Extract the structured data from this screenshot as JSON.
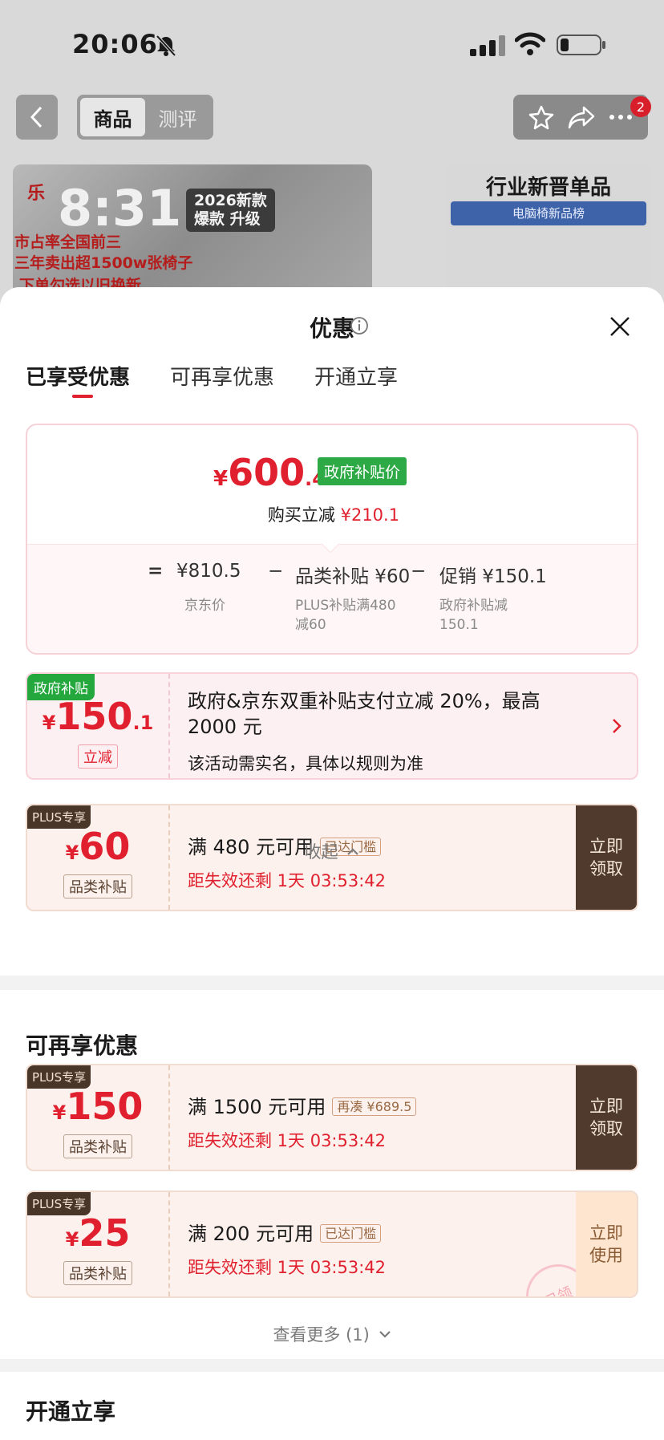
{
  "status_bar": {
    "time": "20:06"
  },
  "nav": {
    "tab_product": "商品",
    "tab_review": "测评",
    "badge_count": "2"
  },
  "banner": {
    "logo": "乐",
    "clock": "8:31",
    "tag_line1": "2026新款",
    "tag_line2": "爆款 升级",
    "line1": "市占率全国前三",
    "line2": "三年卖出超1500w张椅子",
    "line3": "下单勾选以旧换新",
    "side_title": "行业新晋单品",
    "side_strip": "电脑椅新品榜"
  },
  "sheet": {
    "title": "优惠",
    "tabs": [
      "已享受优惠",
      "可再享优惠",
      "开通立享"
    ]
  },
  "summary": {
    "currency": "¥",
    "price_int": "600",
    "price_dec": ".4",
    "gov_tag": "政府补贴价",
    "reduce_label": "购买立减",
    "reduce_amount": "¥210.1",
    "formula": {
      "eq": "=",
      "jd_price": "¥810.5",
      "minus1": "−",
      "category": "品类补贴 ¥60",
      "minus2": "−",
      "promo": "促销 ¥150.1",
      "jd_label": "京东价",
      "category_sub1": "PLUS补贴满480",
      "category_sub2": "减60",
      "promo_sub1": "政府补贴减",
      "promo_sub2": "150.1"
    }
  },
  "coupon_gov": {
    "tag": "政府补贴",
    "currency": "¥",
    "amount_int": "150",
    "amount_dec": ".1",
    "label": "立减",
    "title_line1": "政府&京东双重补贴支付立减 20%，最高",
    "title_line2": "2000 元",
    "note": "该活动需实名，具体以规则为准"
  },
  "coupon_plus60": {
    "tag": "PLUS专享",
    "currency": "¥",
    "amount": "60",
    "label": "品类补贴",
    "condition": "满 480 元可用",
    "status": "已达门槛",
    "timer": "距失效还剩 1天 03:53:42",
    "btn_line1": "立即",
    "btn_line2": "领取"
  },
  "collapse_label": "收起",
  "section_more": {
    "title": "可再享优惠",
    "coupon150": {
      "tag": "PLUS专享",
      "currency": "¥",
      "amount": "150",
      "label": "品类补贴",
      "condition": "满 1500 元可用",
      "status": "再凑 ¥689.5",
      "timer": "距失效还剩 1天 03:53:42",
      "btn_line1": "立即",
      "btn_line2": "领取"
    },
    "coupon25": {
      "tag": "PLUS专享",
      "currency": "¥",
      "amount": "25",
      "label": "品类补贴",
      "condition": "满 200 元可用",
      "status": "已达门槛",
      "timer": "距失效还剩 1天 03:53:42",
      "btn_line1": "立即",
      "btn_line2": "使用",
      "stamp": "已领"
    },
    "see_more": "查看更多 (1)"
  },
  "section_open": {
    "title": "开通立享"
  },
  "colors": {
    "accent_red": "#e0202e",
    "gov_green": "#2daa45",
    "plus_brown": "#4f3a2d"
  }
}
